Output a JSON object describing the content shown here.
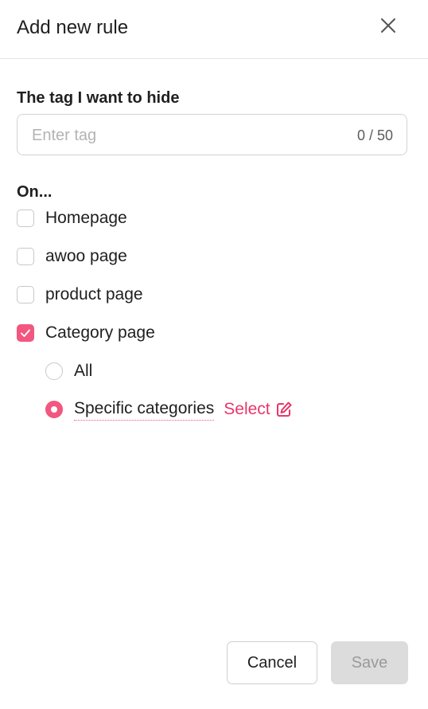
{
  "dialog": {
    "title": "Add new rule",
    "close_icon": "close-icon"
  },
  "tag_field": {
    "label": "The tag I want to hide",
    "placeholder": "Enter tag",
    "value": "",
    "counter": "0 / 50"
  },
  "on_section": {
    "label": "On...",
    "pages": [
      {
        "label": "Homepage",
        "checked": false
      },
      {
        "label": "awoo page",
        "checked": false
      },
      {
        "label": "product page",
        "checked": false
      },
      {
        "label": "Category page",
        "checked": true
      }
    ],
    "category_options": [
      {
        "label": "All",
        "selected": false
      },
      {
        "label": "Specific categories",
        "selected": true
      }
    ],
    "select_link": "Select",
    "select_icon": "edit-icon"
  },
  "footer": {
    "cancel_label": "Cancel",
    "save_label": "Save",
    "save_disabled": true
  },
  "colors": {
    "accent": "#f2577f",
    "link": "#e8366a",
    "disabled_bg": "#dcdcdc"
  }
}
